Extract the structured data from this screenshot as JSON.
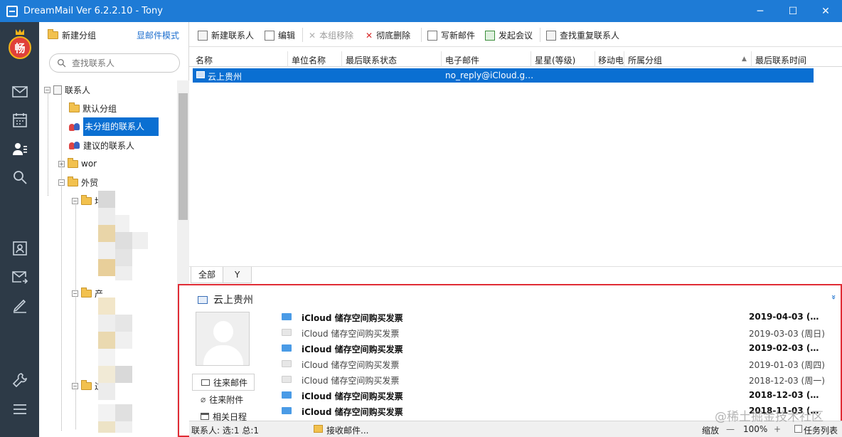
{
  "window": {
    "title": "DreamMail Ver 6.2.2.10  -  Tony"
  },
  "nav": {
    "logo_text": "畅"
  },
  "left": {
    "new_group": "新建分组",
    "mail_mode": "显邮件模式",
    "search_placeholder": "查找联系人",
    "tree": {
      "root": "联系人",
      "default_group": "默认分组",
      "ungrouped": "未分组的联系人",
      "suggested": "建议的联系人",
      "wor": "wor",
      "trade": "外贸",
      "sub1": "均",
      "sub2": "产",
      "sub3": "过"
    }
  },
  "toolbar": {
    "new_contact": "新建联系人",
    "edit": "编辑",
    "remove_from_group": "本组移除",
    "delete": "彻底删除",
    "write_mail": "写新邮件",
    "meeting": "发起会议",
    "find_duplicates": "查找重复联系人"
  },
  "table": {
    "columns": [
      "名称",
      "单位名称",
      "最后联系状态",
      "电子邮件",
      "星星(等级)",
      "移动电",
      "所属分组",
      "最后联系时间"
    ],
    "sort_indicator": "▲",
    "rows": [
      {
        "name": "云上贵州",
        "company": "",
        "status": "",
        "email": "no_reply@iCloud.g…",
        "stars": "",
        "mobile": "",
        "group": "",
        "last_time": ""
      }
    ]
  },
  "tabs": [
    {
      "label": "全部"
    },
    {
      "label": "Y"
    }
  ],
  "details": {
    "name": "云上贵州",
    "collapse_glyph": "»",
    "side_tabs": {
      "mail": "往来邮件",
      "attach": "往来附件",
      "calendar": "相关日程"
    },
    "mails": [
      {
        "subject": "iCloud 储存空间购买发票",
        "date": "2019-04-03 (…",
        "unread": true
      },
      {
        "subject": "iCloud 储存空间购买发票",
        "date": "2019-03-03 (周日)",
        "unread": false
      },
      {
        "subject": "iCloud 储存空间购买发票",
        "date": "2019-02-03 (…",
        "unread": true
      },
      {
        "subject": "iCloud 储存空间购买发票",
        "date": "2019-01-03 (周四)",
        "unread": false
      },
      {
        "subject": "iCloud 储存空间购买发票",
        "date": "2018-12-03 (周一)",
        "unread": false
      },
      {
        "subject": "iCloud 储存空间购买发票",
        "date": "2018-12-03 (…",
        "unread": true
      },
      {
        "subject": "iCloud 储存空间购买发票",
        "date": "2018-11-03 (…",
        "unread": true
      }
    ]
  },
  "status": {
    "contacts": "联系人: 选:1 总:1",
    "receiving": "接收邮件...",
    "zoom_label": "缩放",
    "zoom_out": "—",
    "zoom_value": "100%",
    "zoom_in": "+",
    "task_list": "任务列表"
  },
  "watermark": "@稀土掘金技术社区",
  "colors": {
    "titlebar": "#1e7bd6",
    "nav": "#2d3a47",
    "selection": "#0a6fd2",
    "highlight_border": "#e02c35"
  }
}
